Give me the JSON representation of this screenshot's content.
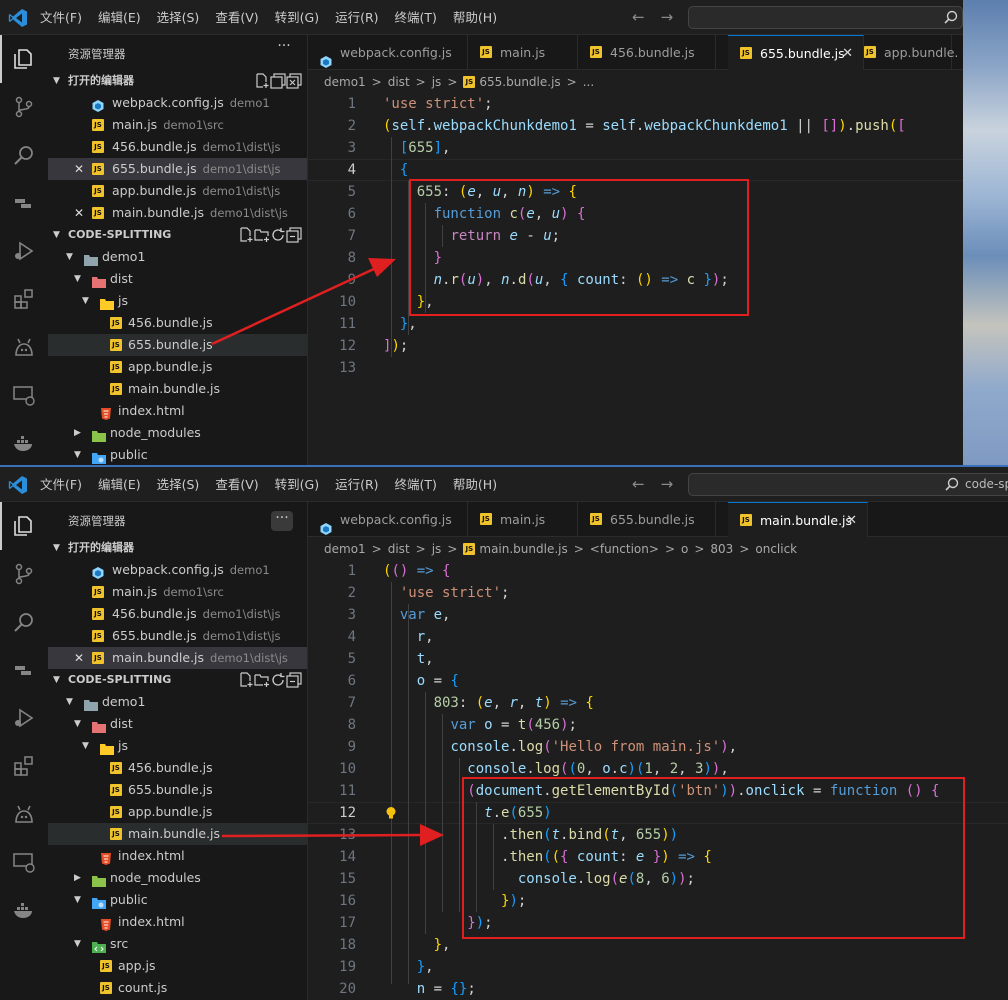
{
  "colors": {
    "accent": "#0078d4",
    "red_highlight": "#e02020",
    "js_icon": "#f0c22c",
    "html_icon": "#e44d26"
  },
  "pane1": {
    "menu": [
      "文件(F)",
      "编辑(E)",
      "选择(S)",
      "查看(V)",
      "转到(G)",
      "运行(R)",
      "终端(T)",
      "帮助(H)"
    ],
    "search_text": "",
    "explorer_title": "资源管理器",
    "more": "···",
    "open_editors_label": "打开的编辑器",
    "open_editors": [
      {
        "name": "webpack.config.js",
        "desc": "demo1",
        "icon": "webpack-icon"
      },
      {
        "name": "main.js",
        "desc": "demo1\\src",
        "icon": "js-file-icon"
      },
      {
        "name": "456.bundle.js",
        "desc": "demo1\\dist\\js",
        "icon": "js-file-icon"
      },
      {
        "name": "655.bundle.js",
        "desc": "demo1\\dist\\js",
        "icon": "js-file-icon"
      },
      {
        "name": "app.bundle.js",
        "desc": "demo1\\dist\\js",
        "icon": "js-file-icon"
      },
      {
        "name": "main.bundle.js",
        "desc": "demo1\\dist\\js",
        "icon": "js-file-icon"
      }
    ],
    "workspace_label": "CODE-SPLITTING",
    "tree": [
      "demo1",
      "dist",
      "js",
      "456.bundle.js",
      "655.bundle.js",
      "app.bundle.js",
      "main.bundle.js",
      "index.html",
      "node_modules",
      "public"
    ],
    "tabs": [
      "webpack.config.js",
      "main.js",
      "456.bundle.js",
      "655.bundle.js",
      "app.bundle."
    ],
    "breadcrumb": [
      "demo1",
      ">",
      "dist",
      ">",
      "js",
      ">",
      "655.bundle.js",
      ">",
      "..."
    ],
    "line_numbers": [
      "1",
      "2",
      "3",
      "4",
      "5",
      "6",
      "7",
      "8",
      "9",
      "10",
      "11",
      "12",
      "13"
    ]
  },
  "pane2": {
    "menu": [
      "文件(F)",
      "编辑(E)",
      "选择(S)",
      "查看(V)",
      "转到(G)",
      "运行(R)",
      "终端(T)",
      "帮助(H)"
    ],
    "search_text": "code-spli",
    "explorer_title": "资源管理器",
    "more": "···",
    "open_editors_label": "打开的编辑器",
    "open_editors": [
      {
        "name": "webpack.config.js",
        "desc": "demo1",
        "icon": "webpack-icon"
      },
      {
        "name": "main.js",
        "desc": "demo1\\src",
        "icon": "js-file-icon"
      },
      {
        "name": "456.bundle.js",
        "desc": "demo1\\dist\\js",
        "icon": "js-file-icon"
      },
      {
        "name": "655.bundle.js",
        "desc": "demo1\\dist\\js",
        "icon": "js-file-icon"
      },
      {
        "name": "main.bundle.js",
        "desc": "demo1\\dist\\js",
        "icon": "js-file-icon"
      }
    ],
    "workspace_label": "CODE-SPLITTING",
    "tree": [
      "demo1",
      "dist",
      "js",
      "456.bundle.js",
      "655.bundle.js",
      "app.bundle.js",
      "main.bundle.js",
      "index.html",
      "node_modules",
      "public",
      "index.html",
      "src",
      "app.js",
      "count.js"
    ],
    "tabs": [
      "webpack.config.js",
      "main.js",
      "655.bundle.js",
      "main.bundle.js"
    ],
    "breadcrumb": [
      "demo1",
      ">",
      "dist",
      ">",
      "js",
      ">",
      "main.bundle.js",
      ">",
      "<function>",
      ">",
      "o",
      ">",
      "803",
      ">",
      "onclick"
    ],
    "line_numbers": [
      "1",
      "2",
      "3",
      "4",
      "5",
      "6",
      "7",
      "8",
      "9",
      "10",
      "11",
      "12",
      "13",
      "14",
      "15",
      "16",
      "17",
      "18",
      "19",
      "20"
    ]
  }
}
